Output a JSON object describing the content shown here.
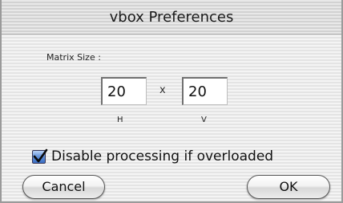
{
  "window": {
    "title": "vbox Preferences"
  },
  "matrix": {
    "label": "Matrix Size :",
    "h_value": "20",
    "v_value": "20",
    "separator": "x",
    "h_label": "H",
    "v_label": "V"
  },
  "options": {
    "disable_processing_label": "Disable processing if overloaded",
    "disable_processing_checked": true
  },
  "buttons": {
    "cancel_label": "Cancel",
    "ok_label": "OK"
  },
  "colors": {
    "checkbox_accent": "#4a7fd0"
  },
  "icons": {
    "checkbox": "check-mark-icon"
  }
}
